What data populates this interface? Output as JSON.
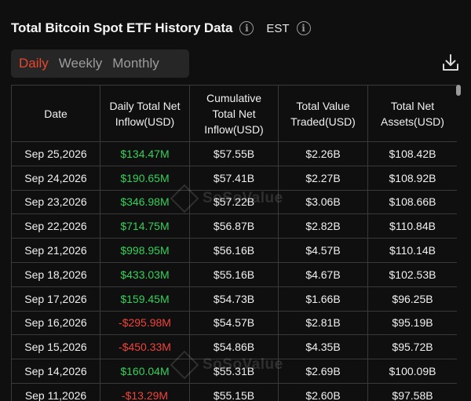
{
  "header": {
    "title": "Total Bitcoin Spot ETF History Data",
    "timezone": "EST"
  },
  "tabs": [
    {
      "label": "Daily",
      "active": true
    },
    {
      "label": "Weekly",
      "active": false
    },
    {
      "label": "Monthly",
      "active": false
    }
  ],
  "table": {
    "columns": [
      "Date",
      "Daily Total Net Inflow(USD)",
      "Cumulative Total Net Inflow(USD)",
      "Total Value Traded(USD)",
      "Total Net Assets(USD)"
    ],
    "rows": [
      [
        "Sep 25,2026",
        "$134.47M",
        "$57.55B",
        "$2.26B",
        "$108.42B"
      ],
      [
        "Sep 24,2026",
        "$190.65M",
        "$57.41B",
        "$2.27B",
        "$108.92B"
      ],
      [
        "Sep 23,2026",
        "$346.98M",
        "$57.22B",
        "$3.06B",
        "$108.66B"
      ],
      [
        "Sep 22,2026",
        "$714.75M",
        "$56.87B",
        "$2.82B",
        "$110.84B"
      ],
      [
        "Sep 21,2026",
        "$998.95M",
        "$56.16B",
        "$4.57B",
        "$110.14B"
      ],
      [
        "Sep 18,2026",
        "$433.03M",
        "$55.16B",
        "$4.67B",
        "$102.53B"
      ],
      [
        "Sep 17,2026",
        "$159.45M",
        "$54.73B",
        "$1.66B",
        "$96.25B"
      ],
      [
        "Sep 16,2026",
        "-$295.98M",
        "$54.57B",
        "$2.81B",
        "$95.19B"
      ],
      [
        "Sep 15,2026",
        "-$450.33M",
        "$54.86B",
        "$4.35B",
        "$95.72B"
      ],
      [
        "Sep 14,2026",
        "$160.04M",
        "$55.31B",
        "$2.69B",
        "$100.09B"
      ],
      [
        "Sep 11,2026",
        "-$13.29M",
        "$55.15B",
        "$2.60B",
        "$97.58B"
      ]
    ]
  },
  "colors": {
    "positive": "#35d05b",
    "negative": "#f0443a",
    "accent": "#e8472e"
  },
  "icons": {
    "info": "info-circle-icon",
    "download": "download-icon"
  }
}
